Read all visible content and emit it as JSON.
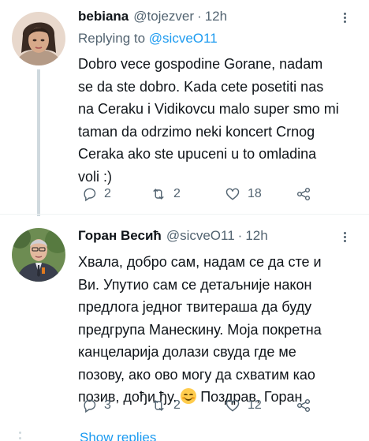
{
  "tweets": [
    {
      "display_name": "bebiana",
      "handle": "@tojezver",
      "separator": "·",
      "time": "12h",
      "reply_prefix": "Replying to",
      "reply_to": "@sicveO11",
      "text": "Dobro vece gospodine Gorane, nadam\nse da ste dobro. Kada cete posetiti nas\nna Ceraku i Vidikovcu malo super smo mi\ntaman da odrzimo neki koncert Crnog\nCeraka ako ste upuceni u to omladina\nvoli :)",
      "replies": "2",
      "retweets": "2",
      "likes": "18"
    },
    {
      "display_name": "Горан Весић",
      "handle": "@sicveO11",
      "separator": "·",
      "time": "12h",
      "text_main": "Хвала, добро сам, надам се да сте и\nВи. Упутио сам се детаљније након\nпредлога једног твитераша да буду\nпредгрупа Манескину. Моја покретна\nканцеларија долази свуда где ме\nпозову, ако ово могу да схватим као\nпозив, дођи ђу. ",
      "text_tail": " Поздрав, Горан",
      "emoji": "smiling-face-with-smiling-eyes",
      "replies": "3",
      "retweets": "2",
      "likes": "12"
    }
  ],
  "show_replies_label": "Show replies",
  "colors": {
    "accent": "#1d9bf0",
    "text_primary": "#0f1419",
    "text_secondary": "#536471",
    "thread_line": "#cfd9de"
  },
  "icons": [
    "reply-icon",
    "retweet-icon",
    "like-icon",
    "share-icon",
    "more-icon"
  ]
}
